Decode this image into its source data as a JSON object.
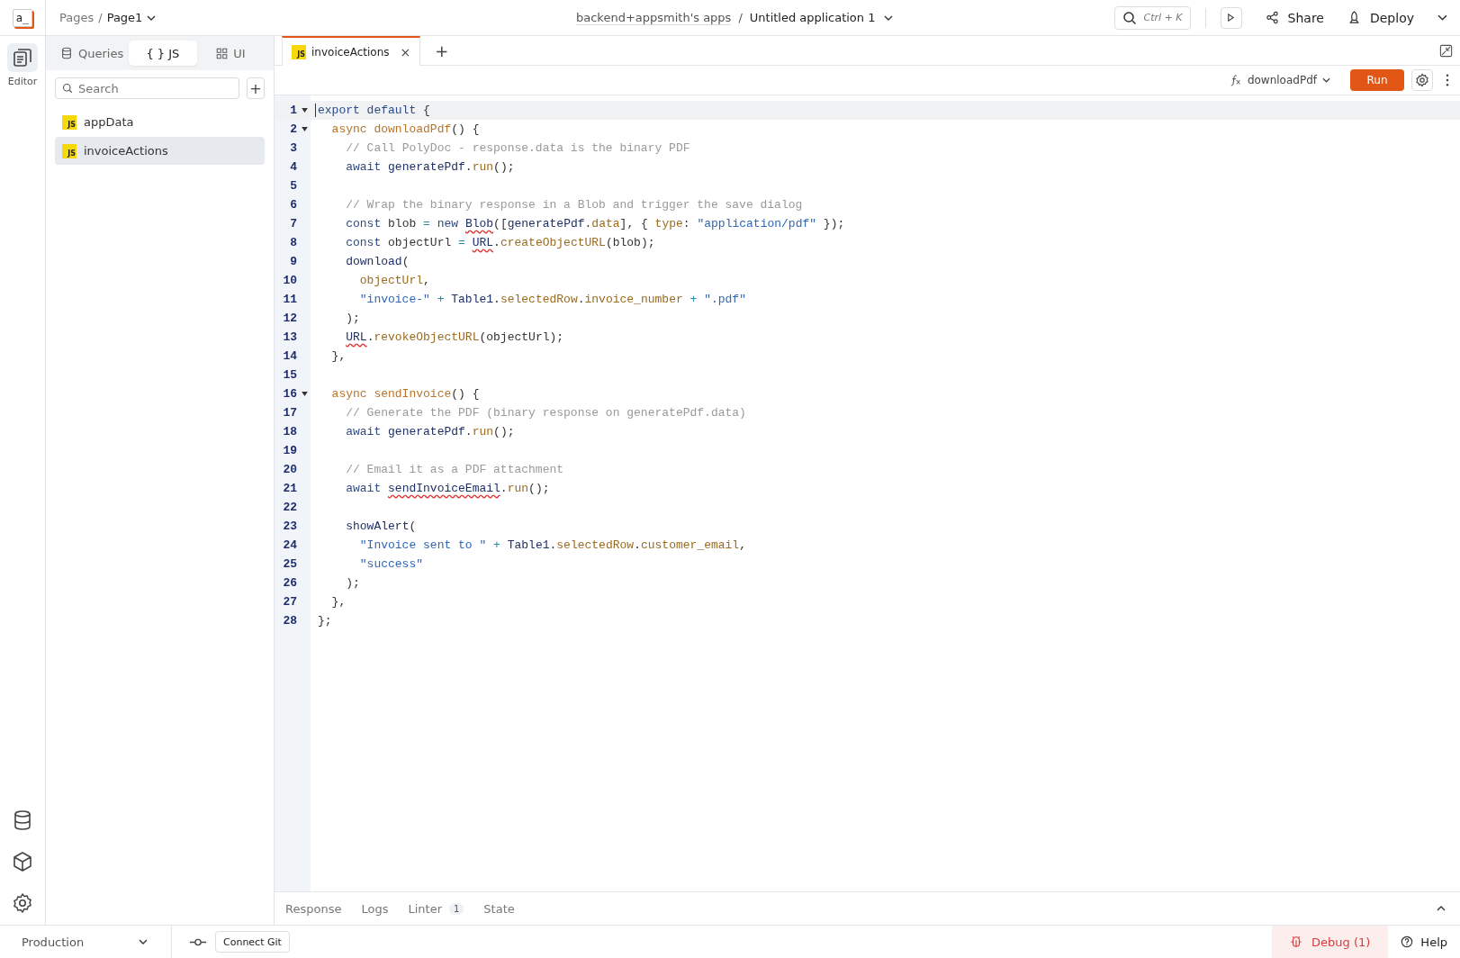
{
  "logo": "a_",
  "app_bar": {
    "breadcrumb_root": "Pages",
    "breadcrumb_separator": "/",
    "page": "Page1",
    "workspace": "backend+appsmith's apps",
    "path_separator": "/",
    "app_name": "Untitled application 1",
    "search_shortcut": "Ctrl + K",
    "share": "Share",
    "deploy": "Deploy"
  },
  "rail": {
    "items": [
      {
        "label": "Editor",
        "selected": true
      }
    ]
  },
  "sidebar": {
    "segments": [
      {
        "kind": "queries",
        "label": "Queries",
        "selected": false
      },
      {
        "kind": "js",
        "label": "{ } JS",
        "selected": true
      },
      {
        "kind": "ui",
        "label": "UI",
        "selected": false
      }
    ],
    "search": {
      "placeholder": "Search"
    },
    "add": "+",
    "items": [
      {
        "badge": "JS",
        "name": "appData",
        "selected": false
      },
      {
        "badge": "JS",
        "name": "invoiceActions",
        "selected": true
      }
    ]
  },
  "editor": {
    "tabs": [
      {
        "badge": "JS",
        "label": "invoiceActions",
        "close": "×",
        "selected": true
      }
    ],
    "new_tab": "+",
    "function": "downloadPdf",
    "run": "Run",
    "lines": [
      {
        "n": "1",
        "foldable": true,
        "active": true,
        "tokens": [
          {
            "kind": "kw",
            "t": "export default"
          },
          {
            "kind": "punc",
            "t": " {"
          }
        ]
      },
      {
        "n": "2",
        "foldable": true,
        "active": false,
        "tokens": [
          {
            "kind": "decl",
            "t": "  async downloadPdf"
          },
          {
            "kind": "punc",
            "t": "() {"
          }
        ]
      },
      {
        "n": "3",
        "foldable": false,
        "active": false,
        "tokens": [
          {
            "kind": "comment",
            "t": "    // Call PolyDoc - response.data is the binary PDF"
          }
        ]
      },
      {
        "n": "4",
        "foldable": false,
        "active": false,
        "tokens": [
          {
            "kind": "kw",
            "t": "    await "
          },
          {
            "kind": "var",
            "t": "generatePdf"
          },
          {
            "kind": "punc",
            "t": "."
          },
          {
            "kind": "prop",
            "t": "run"
          },
          {
            "kind": "punc",
            "t": "();"
          }
        ]
      },
      {
        "n": "5",
        "foldable": false,
        "active": false
      },
      {
        "n": "6",
        "foldable": false,
        "active": false,
        "tokens": [
          {
            "kind": "comment",
            "t": "    // Wrap the binary response in a Blob and trigger the save dialog"
          }
        ]
      },
      {
        "n": "7",
        "foldable": false,
        "active": false,
        "tokens": [
          {
            "kind": "kw",
            "t": "    const "
          },
          {
            "kind": "punc",
            "t": "blob "
          },
          {
            "kind": "op",
            "t": "="
          },
          {
            "kind": "kw",
            "t": " new "
          },
          {
            "kind": "var",
            "t": "Blob",
            "err": true
          },
          {
            "kind": "punc",
            "t": "(["
          },
          {
            "kind": "var",
            "t": "generatePdf"
          },
          {
            "kind": "punc",
            "t": "."
          },
          {
            "kind": "prop",
            "t": "data"
          },
          {
            "kind": "punc",
            "t": "], { "
          },
          {
            "kind": "prop",
            "t": "type"
          },
          {
            "kind": "punc",
            "t": ": "
          },
          {
            "kind": "str",
            "t": "\"application/pdf\""
          },
          {
            "kind": "punc",
            "t": " });"
          }
        ]
      },
      {
        "n": "8",
        "foldable": false,
        "active": false,
        "tokens": [
          {
            "kind": "kw",
            "t": "    const "
          },
          {
            "kind": "punc",
            "t": "objectUrl "
          },
          {
            "kind": "op",
            "t": "= "
          },
          {
            "kind": "var",
            "t": "URL",
            "err": true
          },
          {
            "kind": "punc",
            "t": "."
          },
          {
            "kind": "prop",
            "t": "createObjectURL"
          },
          {
            "kind": "punc",
            "t": "(blob);"
          }
        ]
      },
      {
        "n": "9",
        "foldable": false,
        "active": false,
        "tokens": [
          {
            "kind": "var",
            "t": "    download"
          },
          {
            "kind": "punc",
            "t": "("
          }
        ]
      },
      {
        "n": "10",
        "foldable": false,
        "active": false,
        "tokens": [
          {
            "kind": "prop",
            "t": "      objectUrl"
          },
          {
            "kind": "punc",
            "t": ","
          }
        ]
      },
      {
        "n": "11",
        "foldable": false,
        "active": false,
        "tokens": [
          {
            "kind": "str",
            "t": "      \"invoice-\""
          },
          {
            "kind": "op",
            "t": " + "
          },
          {
            "kind": "var",
            "t": "Table1"
          },
          {
            "kind": "punc",
            "t": "."
          },
          {
            "kind": "prop",
            "t": "selectedRow"
          },
          {
            "kind": "punc",
            "t": "."
          },
          {
            "kind": "prop",
            "t": "invoice_number"
          },
          {
            "kind": "op",
            "t": " + "
          },
          {
            "kind": "str",
            "t": "\".pdf\""
          }
        ]
      },
      {
        "n": "12",
        "foldable": false,
        "active": false,
        "tokens": [
          {
            "kind": "punc",
            "t": "    );"
          }
        ]
      },
      {
        "n": "13",
        "foldable": false,
        "active": false,
        "tokens": [
          {
            "kind": "var",
            "t": "    URL",
            "err": true
          },
          {
            "kind": "punc",
            "t": "."
          },
          {
            "kind": "prop",
            "t": "revokeObjectURL"
          },
          {
            "kind": "punc",
            "t": "(objectUrl);"
          }
        ]
      },
      {
        "n": "14",
        "foldable": false,
        "active": false,
        "tokens": [
          {
            "kind": "punc",
            "t": "  },"
          }
        ]
      },
      {
        "n": "15",
        "foldable": false,
        "active": false
      },
      {
        "n": "16",
        "foldable": true,
        "active": false,
        "tokens": [
          {
            "kind": "decl",
            "t": "  async sendInvoice"
          },
          {
            "kind": "punc",
            "t": "() {"
          }
        ]
      },
      {
        "n": "17",
        "foldable": false,
        "active": false,
        "tokens": [
          {
            "kind": "comment",
            "t": "    // Generate the PDF (binary response on generatePdf.data)"
          }
        ]
      },
      {
        "n": "18",
        "foldable": false,
        "active": false,
        "tokens": [
          {
            "kind": "kw",
            "t": "    await "
          },
          {
            "kind": "var",
            "t": "generatePdf"
          },
          {
            "kind": "punc",
            "t": "."
          },
          {
            "kind": "prop",
            "t": "run"
          },
          {
            "kind": "punc",
            "t": "();"
          }
        ]
      },
      {
        "n": "19",
        "foldable": false,
        "active": false
      },
      {
        "n": "20",
        "foldable": false,
        "active": false,
        "tokens": [
          {
            "kind": "comment",
            "t": "    // Email it as a PDF attachment"
          }
        ]
      },
      {
        "n": "21",
        "foldable": false,
        "active": false,
        "tokens": [
          {
            "kind": "kw",
            "t": "    await "
          },
          {
            "kind": "var",
            "t": "sendInvoiceEmail",
            "err": true
          },
          {
            "kind": "punc",
            "t": "."
          },
          {
            "kind": "prop",
            "t": "run"
          },
          {
            "kind": "punc",
            "t": "();"
          }
        ]
      },
      {
        "n": "22",
        "foldable": false,
        "active": false
      },
      {
        "n": "23",
        "foldable": false,
        "active": false,
        "tokens": [
          {
            "kind": "var",
            "t": "    showAlert"
          },
          {
            "kind": "punc",
            "t": "("
          }
        ]
      },
      {
        "n": "24",
        "foldable": false,
        "active": false,
        "tokens": [
          {
            "kind": "str",
            "t": "      \"Invoice sent to \""
          },
          {
            "kind": "op",
            "t": " + "
          },
          {
            "kind": "var",
            "t": "Table1"
          },
          {
            "kind": "punc",
            "t": "."
          },
          {
            "kind": "prop",
            "t": "selectedRow"
          },
          {
            "kind": "punc",
            "t": "."
          },
          {
            "kind": "prop",
            "t": "customer_email"
          },
          {
            "kind": "punc",
            "t": ","
          }
        ]
      },
      {
        "n": "25",
        "foldable": false,
        "active": false,
        "tokens": [
          {
            "kind": "str",
            "t": "      \"success\""
          }
        ]
      },
      {
        "n": "26",
        "foldable": false,
        "active": false,
        "tokens": [
          {
            "kind": "punc",
            "t": "    );"
          }
        ]
      },
      {
        "n": "27",
        "foldable": false,
        "active": false,
        "tokens": [
          {
            "kind": "punc",
            "t": "  },"
          }
        ]
      },
      {
        "n": "28",
        "foldable": false,
        "active": false,
        "tokens": [
          {
            "kind": "punc",
            "t": "};"
          }
        ]
      }
    ]
  },
  "bottom_panel": {
    "tabs": [
      {
        "label": "Response",
        "selected": false
      },
      {
        "label": "Logs",
        "selected": false
      },
      {
        "label": "Linter",
        "count": "1",
        "selected": false
      },
      {
        "label": "State",
        "selected": false
      }
    ]
  },
  "status_bar": {
    "environment": "Production",
    "connect_git": "Connect Git",
    "debug": "Debug (1)",
    "help": "Help"
  }
}
